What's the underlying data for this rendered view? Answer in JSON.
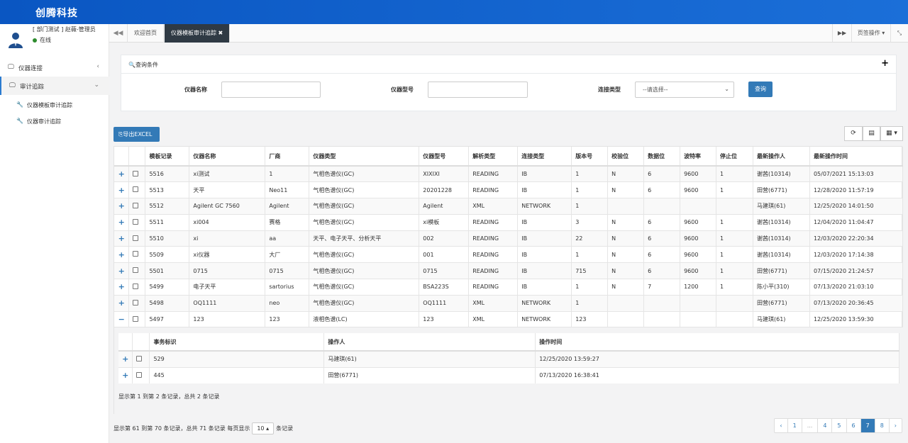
{
  "app": {
    "brand": "创腾科技"
  },
  "user": {
    "name": "[ 部门测试 ] 赵薇-管理员",
    "status": "在线"
  },
  "sidebar": {
    "items": [
      {
        "label": "仪器连接",
        "arrow": "‹"
      },
      {
        "label": "审计追踪",
        "arrow": "⌄"
      }
    ],
    "subitems": [
      {
        "label": "仪器模板审计追踪"
      },
      {
        "label": "仪器审计追踪"
      }
    ]
  },
  "tabs": {
    "prev": "◀◀",
    "items": [
      {
        "label": "欢迎首页"
      },
      {
        "label": "仪器模板审计追踪 ✖"
      }
    ],
    "next": "▶▶",
    "page_ops": "页签操作 ▾",
    "fullscreen": "⤡"
  },
  "query": {
    "title": "查询条件",
    "toggle": "+",
    "name_label": "仪器名称",
    "model_label": "仪器型号",
    "conn_label": "连接类型",
    "name_value": "",
    "model_value": "",
    "conn_value": "--请选择--",
    "submit": "查询"
  },
  "toolbar": {
    "export": "导出EXCEL",
    "refresh": "⟳",
    "toggle_view": "▤",
    "columns": "▦ ▾"
  },
  "table": {
    "headers": [
      "模板记录",
      "仪器名称",
      "厂商",
      "仪器类型",
      "仪器型号",
      "解析类型",
      "连接类型",
      "版本号",
      "校验位",
      "数据位",
      "波特率",
      "停止位",
      "最新操作人",
      "最新操作时间"
    ],
    "rows": [
      {
        "expand": "+",
        "cells": [
          "5516",
          "xi测试",
          "1",
          "气相色谱仪(GC)",
          "XIXIXI",
          "READING",
          "IB",
          "1",
          "N",
          "6",
          "9600",
          "1",
          "谢茜(10314)",
          "05/07/2021 15:13:03"
        ]
      },
      {
        "expand": "+",
        "cells": [
          "5513",
          "天平",
          "Neo11",
          "气相色谱仪(GC)",
          "20201228",
          "READING",
          "IB",
          "1",
          "N",
          "6",
          "9600",
          "1",
          "田营(6771)",
          "12/28/2020 11:57:19"
        ]
      },
      {
        "expand": "+",
        "cells": [
          "5512",
          "Agilent GC 7560",
          "Agilent",
          "气相色谱仪(GC)",
          "Agilent",
          "XML",
          "NETWORK",
          "1",
          "",
          "",
          "",
          "",
          "马建琪(61)",
          "12/25/2020 14:01:50"
        ]
      },
      {
        "expand": "+",
        "cells": [
          "5511",
          "xi004",
          "赛格",
          "气相色谱仪(GC)",
          "xi模板",
          "READING",
          "IB",
          "3",
          "N",
          "6",
          "9600",
          "1",
          "谢茜(10314)",
          "12/04/2020 11:04:47"
        ]
      },
      {
        "expand": "+",
        "cells": [
          "5510",
          "xi",
          "aa",
          "天平、电子天平、分析天平",
          "002",
          "READING",
          "IB",
          "22",
          "N",
          "6",
          "9600",
          "1",
          "谢茜(10314)",
          "12/03/2020 22:20:34"
        ]
      },
      {
        "expand": "+",
        "cells": [
          "5509",
          "xi仪器",
          "大厂",
          "气相色谱仪(GC)",
          "001",
          "READING",
          "IB",
          "1",
          "N",
          "6",
          "9600",
          "1",
          "谢茜(10314)",
          "12/03/2020 17:14:38"
        ]
      },
      {
        "expand": "+",
        "cells": [
          "5501",
          "0715",
          "0715",
          "气相色谱仪(GC)",
          "0715",
          "READING",
          "IB",
          "715",
          "N",
          "6",
          "9600",
          "1",
          "田营(6771)",
          "07/15/2020 21:24:57"
        ]
      },
      {
        "expand": "+",
        "cells": [
          "5499",
          "电子天平",
          "sartorius",
          "气相色谱仪(GC)",
          "BSA223S",
          "READING",
          "IB",
          "1",
          "N",
          "7",
          "1200",
          "1",
          "陈小平(310)",
          "07/13/2020 21:03:10"
        ]
      },
      {
        "expand": "+",
        "cells": [
          "5498",
          "OQ1111",
          "neo",
          "气相色谱仪(GC)",
          "OQ1111",
          "XML",
          "NETWORK",
          "1",
          "",
          "",
          "",
          "",
          "田营(6771)",
          "07/13/2020 20:36:45"
        ]
      },
      {
        "expand": "−",
        "cells": [
          "5497",
          "123",
          "123",
          "液相色谱(LC)",
          "123",
          "XML",
          "NETWORK",
          "123",
          "",
          "",
          "",
          "",
          "马建琪(61)",
          "12/25/2020 13:59:30"
        ]
      }
    ]
  },
  "subtable": {
    "headers": [
      "事务标识",
      "操作人",
      "操作时间"
    ],
    "rows": [
      {
        "expand": "+",
        "cells": [
          "529",
          "马建琪(61)",
          "12/25/2020 13:59:27"
        ]
      },
      {
        "expand": "+",
        "cells": [
          "445",
          "田营(6771)",
          "07/13/2020 16:38:41"
        ]
      }
    ],
    "info": "显示第 1 到第 2 条记录，总共 2 条记录"
  },
  "pagination": {
    "info_prefix": "显示第 61 到第 70 条记录，总共 71 条记录 每页显示",
    "page_size": "10 ▴",
    "info_suffix": "条记录",
    "pages": [
      "‹",
      "1",
      "...",
      "4",
      "5",
      "6",
      "7",
      "8",
      "›"
    ],
    "current": "7"
  }
}
